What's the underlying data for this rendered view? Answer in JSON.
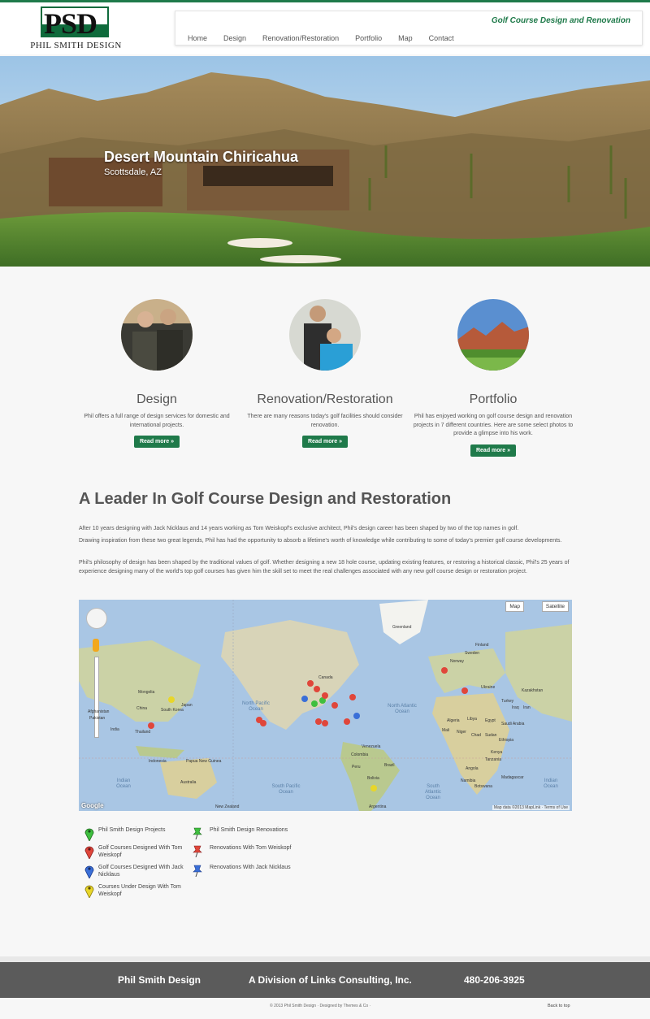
{
  "brand": {
    "logo_letters": "PSD",
    "logo_name": "PHIL SMITH DESIGN",
    "tagline": "Golf Course Design and Renovation",
    "accent": "#1f7a4a"
  },
  "nav": [
    "Home",
    "Design",
    "Renovation/Restoration",
    "Portfolio",
    "Map",
    "Contact"
  ],
  "hero": {
    "title": "Desert Mountain Chiricahua",
    "subtitle": "Scottsdale, AZ"
  },
  "features": [
    {
      "heading": "Design",
      "text": "Phil offers a full range of design services for domestic and international projects.",
      "button": "Read more »"
    },
    {
      "heading": "Renovation/Restoration",
      "text": "There are many reasons today's golf facilities should consider renovation.",
      "button": "Read more »"
    },
    {
      "heading": "Portfolio",
      "text": "Phil has enjoyed working on golf course design and renovation projects in 7 different countries. Here are some select photos to provide a glimpse into his work.",
      "button": "Read more »"
    }
  ],
  "main": {
    "title": "A Leader In Golf Course Design and Restoration",
    "paragraphs": [
      "After 10 years designing with Jack Nicklaus and 14 years working as Tom Weiskopf's exclusive architect, Phil's design career has been shaped by two of the top names in golf.",
      "Drawing inspiration from these two great legends, Phil has had the opportunity to absorb a lifetime's worth of knowledge while contributing to some of today's premier golf course developments.",
      "Phil's philosophy of design has been shaped by the traditional values of golf.  Whether designing a new 18 hole course, updating existing features, or restoring a historical classic, Phil's 25 years of experience designing many of the world's top golf courses has given him the skill set to meet the real challenges associated with any new golf course design or restoration project."
    ]
  },
  "map": {
    "controls": {
      "map": "Map",
      "satellite": "Satellite"
    },
    "attribution": "Map data ©2013 MapLink · Terms of Use",
    "google": "Google",
    "labels": [
      "Greenland",
      "Canada",
      "Mongolia",
      "China",
      "India",
      "Japan",
      "South Korea",
      "Thailand",
      "Indonesia",
      "Papua New Guinea",
      "Kazakhstan",
      "Ukraine",
      "Sweden",
      "Finland",
      "Norway",
      "Algeria",
      "Libya",
      "Egypt",
      "Mali",
      "Niger",
      "Chad",
      "Sudan",
      "Ethiopia",
      "Kenya",
      "Tanzania",
      "Angola",
      "Namibia",
      "Botswana",
      "Madagascar",
      "Saudi Arabia",
      "Iran",
      "Iraq",
      "Turkey",
      "Afghanistan",
      "Pakistan",
      "Venezuela",
      "Colombia",
      "Peru",
      "Brazil",
      "Bolivia",
      "Argentina",
      "Australia",
      "New Zealand"
    ],
    "oceans": [
      "North Pacific Ocean",
      "North Atlantic Ocean",
      "South Pacific Ocean",
      "South Atlantic Ocean",
      "Indian Ocean",
      "Indian Ocean"
    ]
  },
  "legend": [
    {
      "label": "Phil Smith Design Projects",
      "icon": "green-marker-icon",
      "color": "#3fbf3f"
    },
    {
      "label": "Golf Courses Designed With Tom Weiskopf",
      "icon": "red-marker-icon",
      "color": "#e0463a"
    },
    {
      "label": "Golf Courses Designed With Jack Nicklaus",
      "icon": "blue-marker-icon",
      "color": "#3a6fd8"
    },
    {
      "label": "Courses Under Design With Tom Weiskopf",
      "icon": "yellow-marker-icon",
      "color": "#e8d62a"
    },
    {
      "label": "Phil Smith Design Renovations",
      "icon": "green-pin-icon",
      "color": "#3fbf3f"
    },
    {
      "label": "Renovations With Tom Weiskopf",
      "icon": "red-pin-icon",
      "color": "#e0463a"
    },
    {
      "label": "Renovations With Jack Nicklaus",
      "icon": "blue-pin-icon",
      "color": "#3a6fd8"
    }
  ],
  "footer": {
    "company": "Phil Smith Design",
    "division": "A Division of Links Consulting, Inc.",
    "phone": "480-206-3925",
    "copyright": "© 2013 Phil Smith Design · Designed by Themes & Co ·",
    "back_to_top": "Back to top"
  }
}
